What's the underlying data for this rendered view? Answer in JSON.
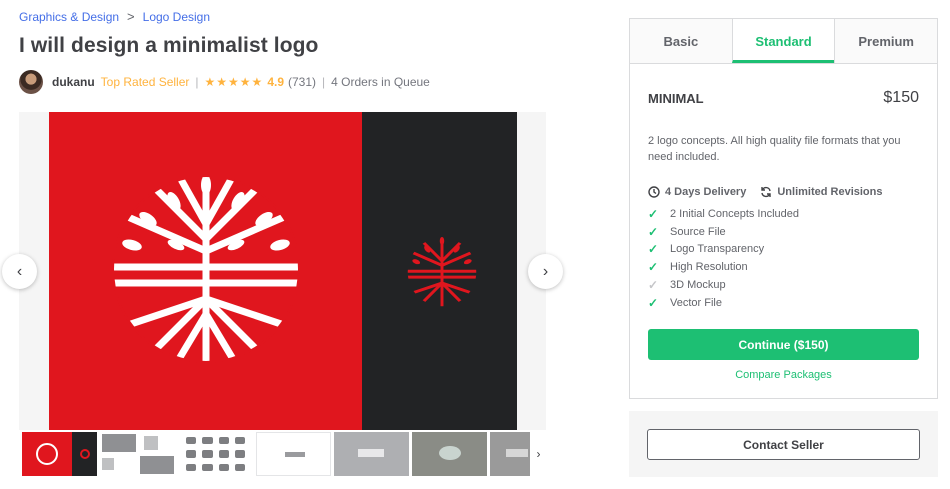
{
  "breadcrumb": {
    "category": "Graphics & Design",
    "separator": ">",
    "subcategory": "Logo Design"
  },
  "gig": {
    "title": "I will design a minimalist logo"
  },
  "seller": {
    "name": "dukanu",
    "badge": "Top Rated Seller",
    "divider": "|",
    "stars": "★★★★★",
    "rating": "4.9",
    "reviews": "(731)",
    "queue": "4 Orders in Queue"
  },
  "gallery": {
    "prev_icon": "‹",
    "next_icon": "›",
    "thumb_more_icon": "›",
    "thumbnail_count": 7
  },
  "packages": {
    "tabs": [
      {
        "label": "Basic",
        "active": false
      },
      {
        "label": "Standard",
        "active": true
      },
      {
        "label": "Premium",
        "active": false
      }
    ],
    "selected": {
      "name": "MINIMAL",
      "price": "$150",
      "description": "2 logo concepts. All high quality file formats that you need included.",
      "delivery": "4 Days Delivery",
      "revisions": "Unlimited Revisions",
      "features": [
        {
          "label": "2 Initial Concepts Included",
          "included": true
        },
        {
          "label": "Source File",
          "included": true
        },
        {
          "label": "Logo Transparency",
          "included": true
        },
        {
          "label": "High Resolution",
          "included": true
        },
        {
          "label": "3D Mockup",
          "included": false
        },
        {
          "label": "Vector File",
          "included": true
        }
      ]
    },
    "continue_label": "Continue ($150)",
    "compare_label": "Compare Packages"
  },
  "contact": {
    "label": "Contact Seller"
  },
  "colors": {
    "accent_green": "#1dbf73",
    "link_blue": "#446ee7",
    "star_gold": "#ffb33e",
    "logo_red": "#e0161e",
    "logo_dark": "#222325"
  }
}
